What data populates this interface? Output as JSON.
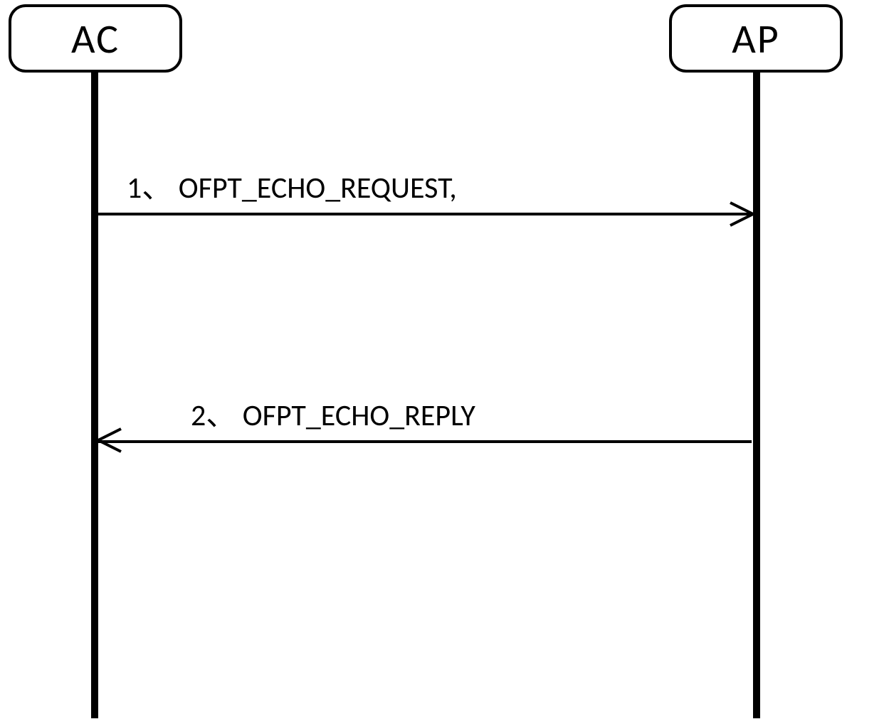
{
  "diagram": {
    "participants": {
      "left": "AC",
      "right": "AP"
    },
    "messages": [
      {
        "index": "1、",
        "label": "OFPT_ECHO_REQUEST,"
      },
      {
        "index": "2、",
        "label": "OFPT_ECHO_REPLY"
      }
    ]
  }
}
